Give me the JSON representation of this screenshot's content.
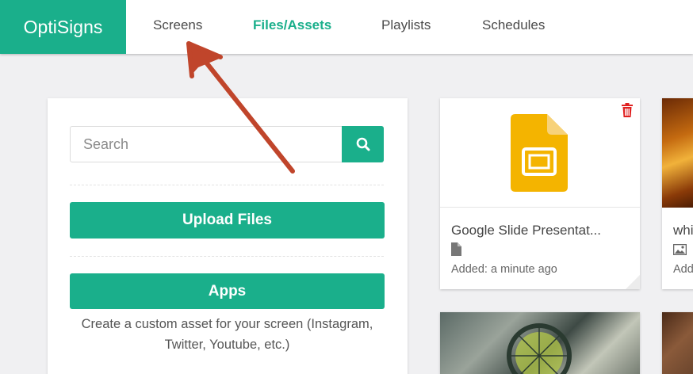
{
  "header": {
    "logo": "OptiSigns",
    "nav": [
      {
        "label": "Screens",
        "active": false
      },
      {
        "label": "Files/Assets",
        "active": true
      },
      {
        "label": "Playlists",
        "active": false
      },
      {
        "label": "Schedules",
        "active": false
      }
    ],
    "accent_color": "#1aaf8b"
  },
  "sidebar": {
    "search": {
      "placeholder": "Search",
      "value": "",
      "icon": "search-icon"
    },
    "upload_label": "Upload Files",
    "apps_label": "Apps",
    "apps_description": "Create a custom asset for your screen (Instagram, Twitter, Youtube, etc.)"
  },
  "assets": [
    {
      "title": "Google Slide Presentat...",
      "type_icon": "file-icon",
      "added": "Added: a minute ago",
      "thumbnail_icon": "google-slides-icon",
      "delete_icon": "trash-icon"
    },
    {
      "title": "whi",
      "type_icon": "image-icon",
      "added": "Add",
      "thumbnail": "photo"
    }
  ],
  "annotation": {
    "arrow_icon": "red-arrow-pointing-to-screens",
    "color": "#c0452b"
  }
}
